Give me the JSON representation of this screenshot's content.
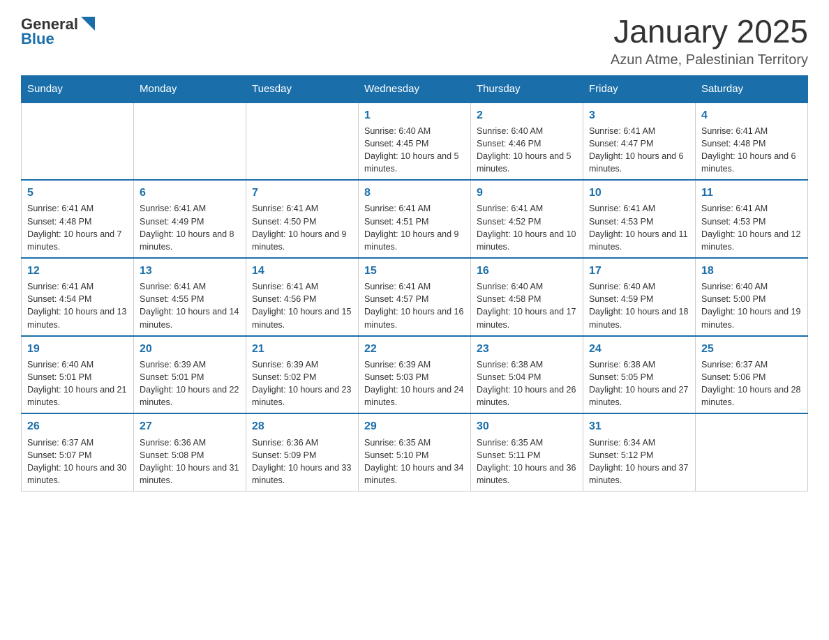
{
  "logo": {
    "general": "General",
    "blue": "Blue"
  },
  "header": {
    "title": "January 2025",
    "location": "Azun Atme, Palestinian Territory"
  },
  "days_of_week": [
    "Sunday",
    "Monday",
    "Tuesday",
    "Wednesday",
    "Thursday",
    "Friday",
    "Saturday"
  ],
  "weeks": [
    [
      {
        "day": "",
        "sunrise": "",
        "sunset": "",
        "daylight": ""
      },
      {
        "day": "",
        "sunrise": "",
        "sunset": "",
        "daylight": ""
      },
      {
        "day": "",
        "sunrise": "",
        "sunset": "",
        "daylight": ""
      },
      {
        "day": "1",
        "sunrise": "Sunrise: 6:40 AM",
        "sunset": "Sunset: 4:45 PM",
        "daylight": "Daylight: 10 hours and 5 minutes."
      },
      {
        "day": "2",
        "sunrise": "Sunrise: 6:40 AM",
        "sunset": "Sunset: 4:46 PM",
        "daylight": "Daylight: 10 hours and 5 minutes."
      },
      {
        "day": "3",
        "sunrise": "Sunrise: 6:41 AM",
        "sunset": "Sunset: 4:47 PM",
        "daylight": "Daylight: 10 hours and 6 minutes."
      },
      {
        "day": "4",
        "sunrise": "Sunrise: 6:41 AM",
        "sunset": "Sunset: 4:48 PM",
        "daylight": "Daylight: 10 hours and 6 minutes."
      }
    ],
    [
      {
        "day": "5",
        "sunrise": "Sunrise: 6:41 AM",
        "sunset": "Sunset: 4:48 PM",
        "daylight": "Daylight: 10 hours and 7 minutes."
      },
      {
        "day": "6",
        "sunrise": "Sunrise: 6:41 AM",
        "sunset": "Sunset: 4:49 PM",
        "daylight": "Daylight: 10 hours and 8 minutes."
      },
      {
        "day": "7",
        "sunrise": "Sunrise: 6:41 AM",
        "sunset": "Sunset: 4:50 PM",
        "daylight": "Daylight: 10 hours and 9 minutes."
      },
      {
        "day": "8",
        "sunrise": "Sunrise: 6:41 AM",
        "sunset": "Sunset: 4:51 PM",
        "daylight": "Daylight: 10 hours and 9 minutes."
      },
      {
        "day": "9",
        "sunrise": "Sunrise: 6:41 AM",
        "sunset": "Sunset: 4:52 PM",
        "daylight": "Daylight: 10 hours and 10 minutes."
      },
      {
        "day": "10",
        "sunrise": "Sunrise: 6:41 AM",
        "sunset": "Sunset: 4:53 PM",
        "daylight": "Daylight: 10 hours and 11 minutes."
      },
      {
        "day": "11",
        "sunrise": "Sunrise: 6:41 AM",
        "sunset": "Sunset: 4:53 PM",
        "daylight": "Daylight: 10 hours and 12 minutes."
      }
    ],
    [
      {
        "day": "12",
        "sunrise": "Sunrise: 6:41 AM",
        "sunset": "Sunset: 4:54 PM",
        "daylight": "Daylight: 10 hours and 13 minutes."
      },
      {
        "day": "13",
        "sunrise": "Sunrise: 6:41 AM",
        "sunset": "Sunset: 4:55 PM",
        "daylight": "Daylight: 10 hours and 14 minutes."
      },
      {
        "day": "14",
        "sunrise": "Sunrise: 6:41 AM",
        "sunset": "Sunset: 4:56 PM",
        "daylight": "Daylight: 10 hours and 15 minutes."
      },
      {
        "day": "15",
        "sunrise": "Sunrise: 6:41 AM",
        "sunset": "Sunset: 4:57 PM",
        "daylight": "Daylight: 10 hours and 16 minutes."
      },
      {
        "day": "16",
        "sunrise": "Sunrise: 6:40 AM",
        "sunset": "Sunset: 4:58 PM",
        "daylight": "Daylight: 10 hours and 17 minutes."
      },
      {
        "day": "17",
        "sunrise": "Sunrise: 6:40 AM",
        "sunset": "Sunset: 4:59 PM",
        "daylight": "Daylight: 10 hours and 18 minutes."
      },
      {
        "day": "18",
        "sunrise": "Sunrise: 6:40 AM",
        "sunset": "Sunset: 5:00 PM",
        "daylight": "Daylight: 10 hours and 19 minutes."
      }
    ],
    [
      {
        "day": "19",
        "sunrise": "Sunrise: 6:40 AM",
        "sunset": "Sunset: 5:01 PM",
        "daylight": "Daylight: 10 hours and 21 minutes."
      },
      {
        "day": "20",
        "sunrise": "Sunrise: 6:39 AM",
        "sunset": "Sunset: 5:01 PM",
        "daylight": "Daylight: 10 hours and 22 minutes."
      },
      {
        "day": "21",
        "sunrise": "Sunrise: 6:39 AM",
        "sunset": "Sunset: 5:02 PM",
        "daylight": "Daylight: 10 hours and 23 minutes."
      },
      {
        "day": "22",
        "sunrise": "Sunrise: 6:39 AM",
        "sunset": "Sunset: 5:03 PM",
        "daylight": "Daylight: 10 hours and 24 minutes."
      },
      {
        "day": "23",
        "sunrise": "Sunrise: 6:38 AM",
        "sunset": "Sunset: 5:04 PM",
        "daylight": "Daylight: 10 hours and 26 minutes."
      },
      {
        "day": "24",
        "sunrise": "Sunrise: 6:38 AM",
        "sunset": "Sunset: 5:05 PM",
        "daylight": "Daylight: 10 hours and 27 minutes."
      },
      {
        "day": "25",
        "sunrise": "Sunrise: 6:37 AM",
        "sunset": "Sunset: 5:06 PM",
        "daylight": "Daylight: 10 hours and 28 minutes."
      }
    ],
    [
      {
        "day": "26",
        "sunrise": "Sunrise: 6:37 AM",
        "sunset": "Sunset: 5:07 PM",
        "daylight": "Daylight: 10 hours and 30 minutes."
      },
      {
        "day": "27",
        "sunrise": "Sunrise: 6:36 AM",
        "sunset": "Sunset: 5:08 PM",
        "daylight": "Daylight: 10 hours and 31 minutes."
      },
      {
        "day": "28",
        "sunrise": "Sunrise: 6:36 AM",
        "sunset": "Sunset: 5:09 PM",
        "daylight": "Daylight: 10 hours and 33 minutes."
      },
      {
        "day": "29",
        "sunrise": "Sunrise: 6:35 AM",
        "sunset": "Sunset: 5:10 PM",
        "daylight": "Daylight: 10 hours and 34 minutes."
      },
      {
        "day": "30",
        "sunrise": "Sunrise: 6:35 AM",
        "sunset": "Sunset: 5:11 PM",
        "daylight": "Daylight: 10 hours and 36 minutes."
      },
      {
        "day": "31",
        "sunrise": "Sunrise: 6:34 AM",
        "sunset": "Sunset: 5:12 PM",
        "daylight": "Daylight: 10 hours and 37 minutes."
      },
      {
        "day": "",
        "sunrise": "",
        "sunset": "",
        "daylight": ""
      }
    ]
  ]
}
